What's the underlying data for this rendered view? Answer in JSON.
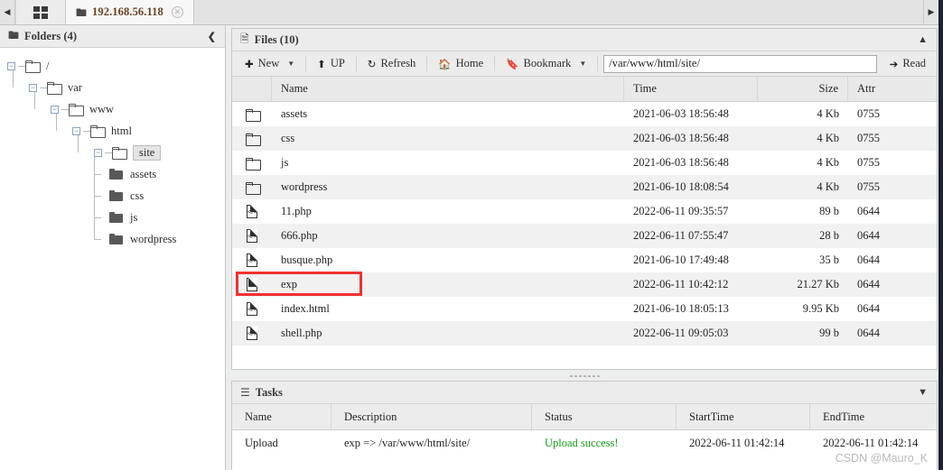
{
  "tabbar": {
    "scroll_left_icon": "caret-left-icon",
    "scroll_right_icon": "caret-right-icon",
    "grid_icon": "grid-icon",
    "tab_folder_icon": "folder-icon",
    "tab_label": "192.168.56.118",
    "tab_close_icon": "close-icon"
  },
  "folders_panel": {
    "icon": "folder-icon",
    "title": "Folders (4)",
    "collapse_icon": "chevron-left-icon",
    "tree": [
      {
        "label": "/",
        "depth": 0,
        "expander": "minus",
        "icon": "folder-outline",
        "selected": false
      },
      {
        "label": "var",
        "depth": 1,
        "expander": "minus",
        "icon": "folder-outline",
        "selected": false
      },
      {
        "label": "www",
        "depth": 2,
        "expander": "minus",
        "icon": "folder-outline",
        "selected": false
      },
      {
        "label": "html",
        "depth": 3,
        "expander": "minus",
        "icon": "folder-outline",
        "selected": false
      },
      {
        "label": "site",
        "depth": 4,
        "expander": "minus",
        "icon": "folder-outline",
        "selected": true
      },
      {
        "label": "assets",
        "depth": 5,
        "expander": "none",
        "icon": "folder-solid",
        "selected": false
      },
      {
        "label": "css",
        "depth": 5,
        "expander": "none",
        "icon": "folder-solid",
        "selected": false
      },
      {
        "label": "js",
        "depth": 5,
        "expander": "none",
        "icon": "folder-solid",
        "selected": false
      },
      {
        "label": "wordpress",
        "depth": 5,
        "expander": "none",
        "icon": "folder-solid",
        "selected": false
      }
    ]
  },
  "files_panel": {
    "icon": "file-icon",
    "title": "Files (10)",
    "collapse_icon": "chevron-up-icon",
    "toolbar": {
      "new_label": "New",
      "new_icon": "circle-plus-icon",
      "new_caret": "caret-down-icon",
      "up_label": "UP",
      "up_icon": "arrow-up-icon",
      "refresh_label": "Refresh",
      "refresh_icon": "refresh-icon",
      "home_label": "Home",
      "home_icon": "home-icon",
      "bookmark_label": "Bookmark",
      "bookmark_icon": "bookmark-icon",
      "bookmark_caret": "caret-down-icon",
      "path_value": "/var/www/html/site/",
      "path_placeholder": "/var/www/html/site/",
      "read_label": "Read",
      "read_icon": "arrow-right-icon"
    },
    "columns": [
      "",
      "Name",
      "Time",
      "Size",
      "Attr"
    ],
    "rows": [
      {
        "icon": "folder",
        "name": "assets",
        "time": "2021-06-03 18:56:48",
        "size": "4 Kb",
        "attr": "0755",
        "highlight": false
      },
      {
        "icon": "folder",
        "name": "css",
        "time": "2021-06-03 18:56:48",
        "size": "4 Kb",
        "attr": "0755",
        "highlight": false
      },
      {
        "icon": "folder",
        "name": "js",
        "time": "2021-06-03 18:56:48",
        "size": "4 Kb",
        "attr": "0755",
        "highlight": false
      },
      {
        "icon": "folder",
        "name": "wordpress",
        "time": "2021-06-10 18:08:54",
        "size": "4 Kb",
        "attr": "0755",
        "highlight": false
      },
      {
        "icon": "code",
        "name": "11.php",
        "time": "2022-06-11 09:35:57",
        "size": "89 b",
        "attr": "0644",
        "highlight": false
      },
      {
        "icon": "code",
        "name": "666.php",
        "time": "2022-06-11 07:55:47",
        "size": "28 b",
        "attr": "0644",
        "highlight": false
      },
      {
        "icon": "code",
        "name": "busque.php",
        "time": "2021-06-10 17:49:48",
        "size": "35 b",
        "attr": "0644",
        "highlight": false
      },
      {
        "icon": "doc",
        "name": "exp",
        "time": "2022-06-11 10:42:12",
        "size": "21.27 Kb",
        "attr": "0644",
        "highlight": true
      },
      {
        "icon": "code",
        "name": "index.html",
        "time": "2021-06-10 18:05:13",
        "size": "9.95 Kb",
        "attr": "0644",
        "highlight": false
      },
      {
        "icon": "code",
        "name": "shell.php",
        "time": "2022-06-11 09:05:03",
        "size": "99 b",
        "attr": "0644",
        "highlight": false
      }
    ],
    "highlight_color": "#f23030"
  },
  "tasks_panel": {
    "icon": "tasks-icon",
    "title": "Tasks",
    "collapse_icon": "chevron-down-icon",
    "columns": [
      "Name",
      "Description",
      "Status",
      "StartTime",
      "EndTime"
    ],
    "rows": [
      {
        "name": "Upload",
        "description": "exp => /var/www/html/site/",
        "status": "Upload success!",
        "status_color": "#14a014",
        "start_time": "2022-06-11 01:42:14",
        "end_time": "2022-06-11 01:42:14"
      }
    ]
  },
  "watermark": "CSDN @Mauro_K"
}
